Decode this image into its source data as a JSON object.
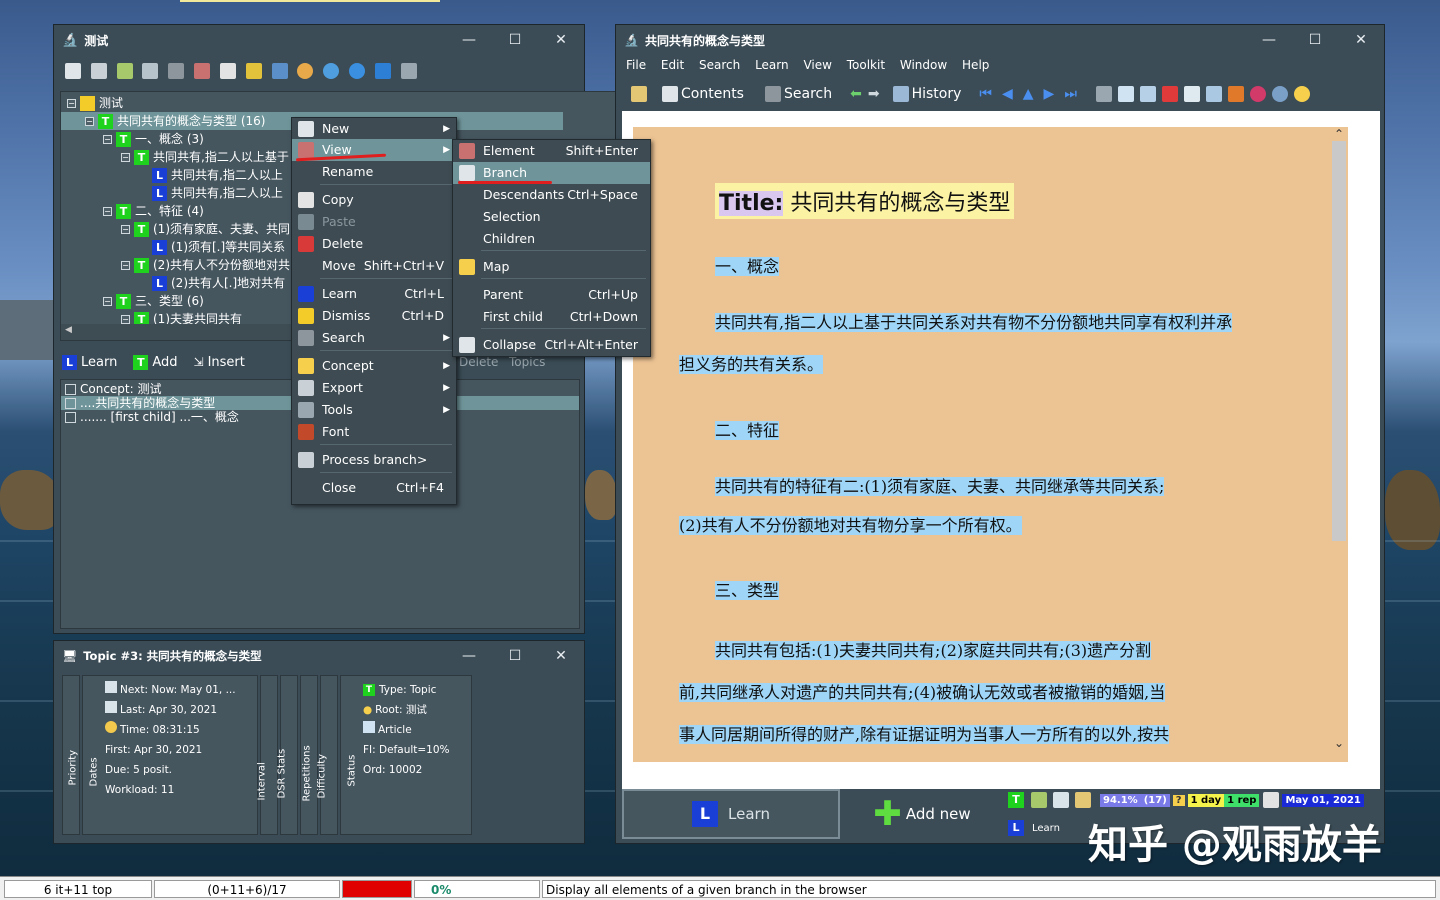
{
  "left_window": {
    "title": "测试",
    "controls": {
      "minimize": "—",
      "maximize": "☐",
      "close": "✕"
    },
    "tree": [
      {
        "text": "测试",
        "icon": "C",
        "level": 0
      },
      {
        "text": "共同共有的概念与类型 (16)",
        "icon": "T",
        "level": 1,
        "selected": true
      },
      {
        "text": "一、概念 (3)",
        "icon": "T",
        "level": 2
      },
      {
        "text": "共同共有,指二人以上基于",
        "icon": "T",
        "level": 3
      },
      {
        "text": "共同共有,指二人以上",
        "icon": "L",
        "level": 4
      },
      {
        "text": "共同共有,指二人以上",
        "icon": "L",
        "level": 4
      },
      {
        "text": "二、特征 (4)",
        "icon": "T",
        "level": 2
      },
      {
        "text": "(1)须有家庭、夫妻、共同",
        "icon": "T",
        "level": 3
      },
      {
        "text": "(1)须有[.]等共同关系",
        "icon": "L",
        "level": 4
      },
      {
        "text": "(2)共有人不分份额地对共",
        "icon": "T",
        "level": 3
      },
      {
        "text": "(2)共有人[.]地对共有",
        "icon": "L",
        "level": 4
      },
      {
        "text": "三、类型 (6)",
        "icon": "T",
        "level": 2
      },
      {
        "text": "(1)夫妻共同共有",
        "icon": "T",
        "level": 3
      }
    ],
    "actions": {
      "learn": "Learn",
      "add": "Add",
      "insert": "Insert",
      "delete": "Delete",
      "topics": "Topics"
    },
    "list": [
      {
        "text": "Concept: 测试"
      },
      {
        "text": "....共同共有的概念与类型",
        "selected": true
      },
      {
        "text": "....... [first child] ...一、概念"
      }
    ]
  },
  "context_menu": {
    "items": [
      {
        "label": "New",
        "shortcut": "",
        "submenu": true
      },
      {
        "label": "View",
        "shortcut": "",
        "submenu": true,
        "highlighted": true
      },
      {
        "label": "Rename",
        "shortcut": ""
      },
      {
        "label": "Copy",
        "shortcut": ""
      },
      {
        "label": "Paste",
        "shortcut": "",
        "disabled": true
      },
      {
        "label": "Delete",
        "shortcut": ""
      },
      {
        "label": "Move",
        "shortcut": "Shift+Ctrl+V"
      },
      {
        "label": "Learn",
        "shortcut": "Ctrl+L"
      },
      {
        "label": "Dismiss",
        "shortcut": "Ctrl+D"
      },
      {
        "label": "Search",
        "shortcut": "",
        "submenu": true
      },
      {
        "label": "Concept",
        "shortcut": "",
        "submenu": true
      },
      {
        "label": "Export",
        "shortcut": "",
        "submenu": true
      },
      {
        "label": "Tools",
        "shortcut": "",
        "submenu": true
      },
      {
        "label": "Font",
        "shortcut": ""
      },
      {
        "label": "Process branch>",
        "shortcut": ""
      },
      {
        "label": "Close",
        "shortcut": "Ctrl+F4"
      }
    ]
  },
  "submenu": {
    "items": [
      {
        "label": "Element",
        "shortcut": "Shift+Enter"
      },
      {
        "label": "Branch",
        "shortcut": "",
        "highlighted": true
      },
      {
        "label": "Descendants",
        "shortcut": "Ctrl+Space"
      },
      {
        "label": "Selection",
        "shortcut": ""
      },
      {
        "label": "Children",
        "shortcut": ""
      },
      {
        "label": "Map",
        "shortcut": ""
      },
      {
        "label": "Parent",
        "shortcut": "Ctrl+Up"
      },
      {
        "label": "First child",
        "shortcut": "Ctrl+Down"
      },
      {
        "label": "Collapse",
        "shortcut": "Ctrl+Alt+Enter"
      }
    ]
  },
  "topic_window": {
    "title": "Topic #3: 共同共有的概念与类型",
    "stats": {
      "next": "Next: Now: May 01, ...",
      "last": "Last: Apr 30, 2021",
      "time": "Time: 08:31:15",
      "first": "First: Apr 30, 2021",
      "due": "Due: 5 posit.",
      "workload": "Workload: 11"
    },
    "side_labels": [
      "Priority",
      "Dates",
      "Interval",
      "DSR Stats",
      "Repetitions",
      "Difficulty",
      "Status"
    ],
    "info": {
      "type": "Type: Topic",
      "root": "Root: 测试",
      "article": "Article",
      "fi": "FI: Default=10%",
      "ord": "Ord: 10002"
    }
  },
  "right_window": {
    "title": "共同共有的概念与类型",
    "menu": [
      "File",
      "Edit",
      "Search",
      "Learn",
      "View",
      "Toolkit",
      "Window",
      "Help"
    ],
    "toolbar": {
      "contents": "Contents",
      "search": "Search",
      "history": "History"
    },
    "document": {
      "title_label": "Title:",
      "title": "共同共有的概念与类型",
      "h1": "一、概念",
      "p1a": "共同共有,指二人以上基于共同关系对共有物不分份额地共同享有权利并承",
      "p1b": "担义务的共有关系。",
      "h2": "二、特征",
      "p2a": "共同共有的特征有二:(1)须有家庭、夫妻、共同继承等共同关系;",
      "p2b": "(2)共有人不分份额地对共有物分享一个所有权。",
      "h3": "三、类型",
      "p3a": "共同共有包括:(1)夫妻共同共有;(2)家庭共同共有;(3)遗产分割",
      "p3b": "前,共同继承人对遗产的共同共有;(4)被确认无效或者被撤销的婚姻,当",
      "p3c": "事人同居期间所得的财产,除有证据证明为当事人一方所有的以外,按共"
    },
    "bottom": {
      "learn": "Learn",
      "add_new": "Add new",
      "learn_small": "Learn",
      "badge_pct": "94.1%",
      "badge_count": "(17)",
      "badge_day": "1 day",
      "badge_rep": "1 rep",
      "badge_date": "May 01, 2021"
    }
  },
  "watermark": "知乎 @观雨放羊",
  "statusbar": {
    "cell1": "6 it+11 top",
    "cell2": "(0+11+6)/17",
    "cell3": "0%",
    "message": "Display all elements of a given branch in the browser"
  },
  "colors": {
    "window_bg": "#3b4c56",
    "doc_bg": "#ecc393",
    "highlight_text": "#9fd6f7",
    "menu_highlight": "#6f959a",
    "status_red": "#e00000"
  }
}
